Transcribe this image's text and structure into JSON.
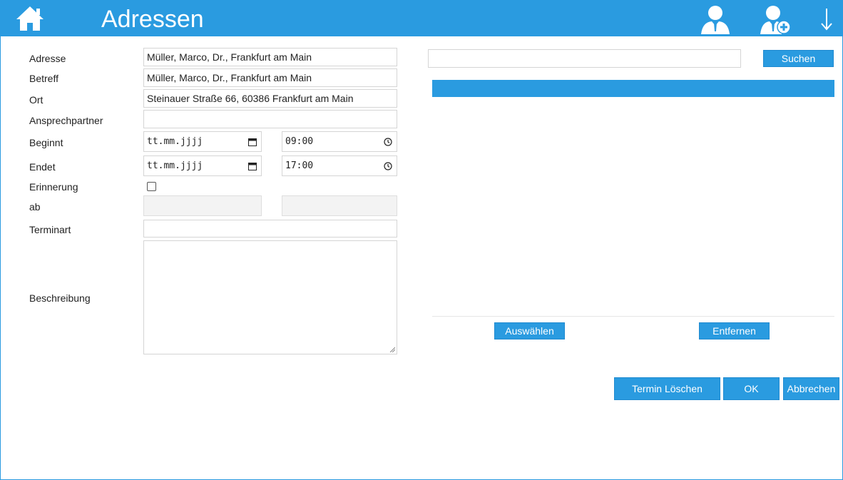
{
  "header": {
    "title": "Adressen",
    "accent_color": "#2a9be0",
    "icons": [
      "home-icon",
      "user-icon",
      "user-add-icon",
      "arrow-down-icon"
    ]
  },
  "form": {
    "labels": {
      "adresse": "Adresse",
      "betreff": "Betreff",
      "ort": "Ort",
      "ansprechpartner": "Ansprechpartner",
      "beginnt": "Beginnt",
      "endet": "Endet",
      "erinnerung": "Erinnerung",
      "ab": "ab",
      "terminart": "Terminart",
      "beschreibung": "Beschreibung"
    },
    "values": {
      "adresse": "Müller, Marco, Dr., Frankfurt am Main",
      "betreff": "Müller, Marco, Dr., Frankfurt am Main",
      "ort": "Steinauer Straße 66, 60386 Frankfurt am Main",
      "ansprechpartner": "",
      "beginnt_date": "tt.mm.jjjj",
      "beginnt_time": "09:00",
      "endet_date": "tt.mm.jjjj",
      "endet_time": "17:00",
      "erinnerung_checked": false,
      "terminart": "",
      "beschreibung": ""
    }
  },
  "search": {
    "value": "",
    "button_label": "Suchen"
  },
  "results": {
    "select_label": "Auswählen",
    "remove_label": "Entfernen"
  },
  "actions": {
    "delete_label": "Termin Löschen",
    "ok_label": "OK",
    "cancel_label": "Abbrechen"
  }
}
